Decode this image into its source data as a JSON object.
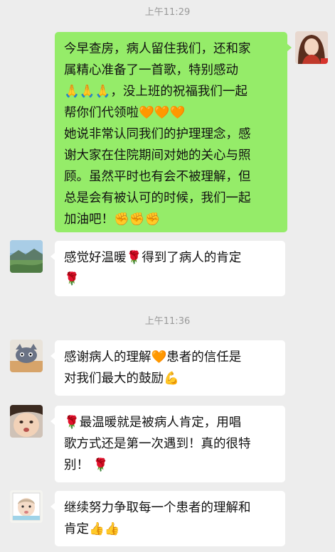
{
  "timestamps": [
    "上午11:29",
    "上午11:36"
  ],
  "messages": [
    {
      "sender": "self",
      "lines": [
        "今早查房，病人留住我们，还和家",
        "属精心准备了一首歌，特别感动",
        "🙏🙏🙏，没上班的祝福我们一起",
        "帮你们代领啦🧡🧡🧡",
        "她说非常认同我们的护理理念，感",
        "谢大家在住院期间对她的关心与照",
        "顾。虽然平时也有会不被理解，但",
        "总是会有被认可的时候，我们一起",
        "加油吧！✊✊✊"
      ]
    },
    {
      "sender": "other",
      "lines": [
        "感觉好温暖🌹得到了病人的肯定",
        "🌹"
      ]
    },
    {
      "sender": "other",
      "lines": [
        "感谢病人的理解🧡患者的信任是",
        "对我们最大的鼓励💪"
      ]
    },
    {
      "sender": "other",
      "lines": [
        "🌹最温暖就是被病人肯定，用唱",
        "歌方式还是第一次遇到！真的很特",
        "别！ 🌹"
      ]
    },
    {
      "sender": "other",
      "lines": [
        "继续努力争取每一个患者的理解和",
        "肯定👍👍"
      ]
    }
  ],
  "avatars": [
    "self-avatar-photo",
    "landscape-avatar",
    "cartoon-cat-avatar",
    "baby-face-avatar",
    "baby-photo-avatar"
  ]
}
